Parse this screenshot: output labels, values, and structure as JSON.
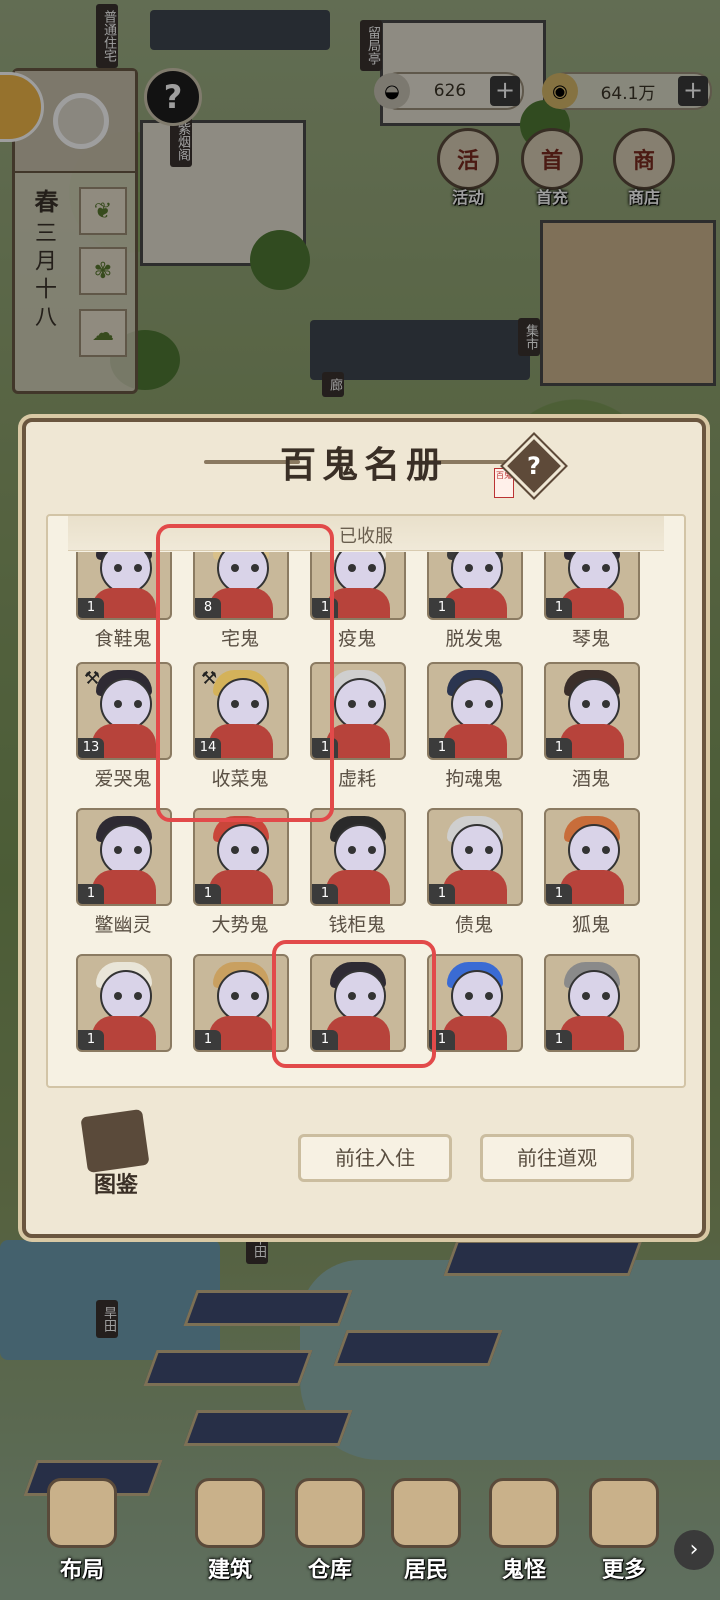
{
  "season": {
    "name": "春",
    "date": "三月十八"
  },
  "resources": {
    "ingot_value": "626",
    "coin_value": "64.1万",
    "plus": "+"
  },
  "top_buttons": [
    {
      "label": "活动",
      "glyph": "活"
    },
    {
      "label": "首充",
      "glyph": "首"
    },
    {
      "label": "商店",
      "glyph": "商"
    }
  ],
  "signs": [
    "普通住宅",
    "留局亭",
    "紫烟阁",
    "集市",
    "廊",
    "旱田",
    "旱田"
  ],
  "modal": {
    "title": "百鬼名册",
    "seal_text": "百鬼",
    "tab_label": "已收服",
    "codex_label": "图鉴",
    "btn_residence": "前往入住",
    "btn_temple": "前往道观"
  },
  "ghosts": [
    {
      "name": "食鞋鬼",
      "level": "1"
    },
    {
      "name": "宅鬼",
      "level": "8"
    },
    {
      "name": "疫鬼",
      "level": "1"
    },
    {
      "name": "脱发鬼",
      "level": "1"
    },
    {
      "name": "琴鬼",
      "level": "1"
    },
    {
      "name": "爱哭鬼",
      "level": "13"
    },
    {
      "name": "收菜鬼",
      "level": "14"
    },
    {
      "name": "虚耗",
      "level": "1"
    },
    {
      "name": "拘魂鬼",
      "level": "1"
    },
    {
      "name": "酒鬼",
      "level": "1"
    },
    {
      "name": "鳖幽灵",
      "level": "1"
    },
    {
      "name": "大势鬼",
      "level": "1"
    },
    {
      "name": "钱柜鬼",
      "level": "1"
    },
    {
      "name": "债鬼",
      "level": "1"
    },
    {
      "name": "狐鬼",
      "level": "1"
    },
    {
      "name": "",
      "level": "1"
    },
    {
      "name": "",
      "level": "1"
    },
    {
      "name": "",
      "level": "1"
    },
    {
      "name": "",
      "level": "1"
    },
    {
      "name": "",
      "level": "1"
    }
  ],
  "nav": [
    "布局",
    "建筑",
    "仓库",
    "居民",
    "鬼怪",
    "更多"
  ],
  "colors": {
    "highlight": "#e24a4a",
    "panel": "#efe7d4",
    "frame": "#6a563f"
  }
}
